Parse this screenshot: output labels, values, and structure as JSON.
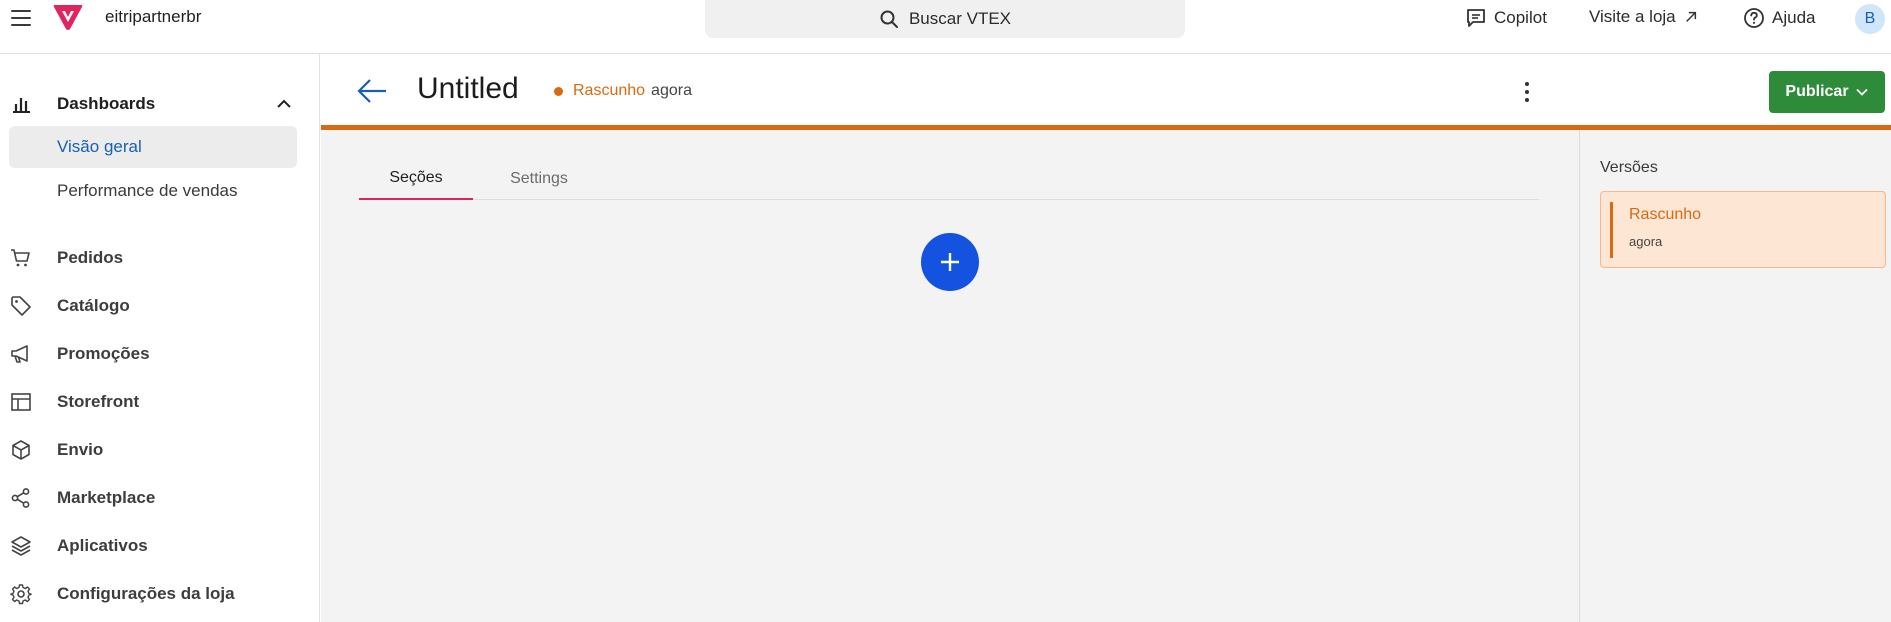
{
  "topbar": {
    "account": "eitripartnerbr",
    "search_label": "Buscar VTEX",
    "copilot": "Copilot",
    "visit_store": "Visite a loja",
    "help": "Ajuda",
    "avatar_initial": "B",
    "brand_color": "#e0245e"
  },
  "sidebar": {
    "group": {
      "label": "Dashboards",
      "icon": "bar-chart-icon",
      "items": [
        {
          "label": "Visão geral",
          "active": true
        },
        {
          "label": "Performance de vendas",
          "active": false
        }
      ]
    },
    "items": [
      {
        "label": "Pedidos",
        "icon": "cart-icon"
      },
      {
        "label": "Catálogo",
        "icon": "tag-icon"
      },
      {
        "label": "Promoções",
        "icon": "megaphone-icon"
      },
      {
        "label": "Storefront",
        "icon": "layout-icon"
      },
      {
        "label": "Envio",
        "icon": "box-icon"
      },
      {
        "label": "Marketplace",
        "icon": "share-icon"
      },
      {
        "label": "Aplicativos",
        "icon": "layers-icon"
      },
      {
        "label": "Configurações da loja",
        "icon": "gear-icon"
      }
    ]
  },
  "page": {
    "title": "Untitled",
    "status": "Rascunho",
    "status_time": "agora",
    "status_color": "#d96a12",
    "publish_label": "Publicar",
    "publish_color": "#2e8b3a"
  },
  "tabs": [
    {
      "label": "Seções",
      "active": true
    },
    {
      "label": "Settings",
      "active": false
    }
  ],
  "versions": {
    "title": "Versões",
    "items": [
      {
        "name": "Rascunho",
        "time": "agora"
      }
    ]
  }
}
